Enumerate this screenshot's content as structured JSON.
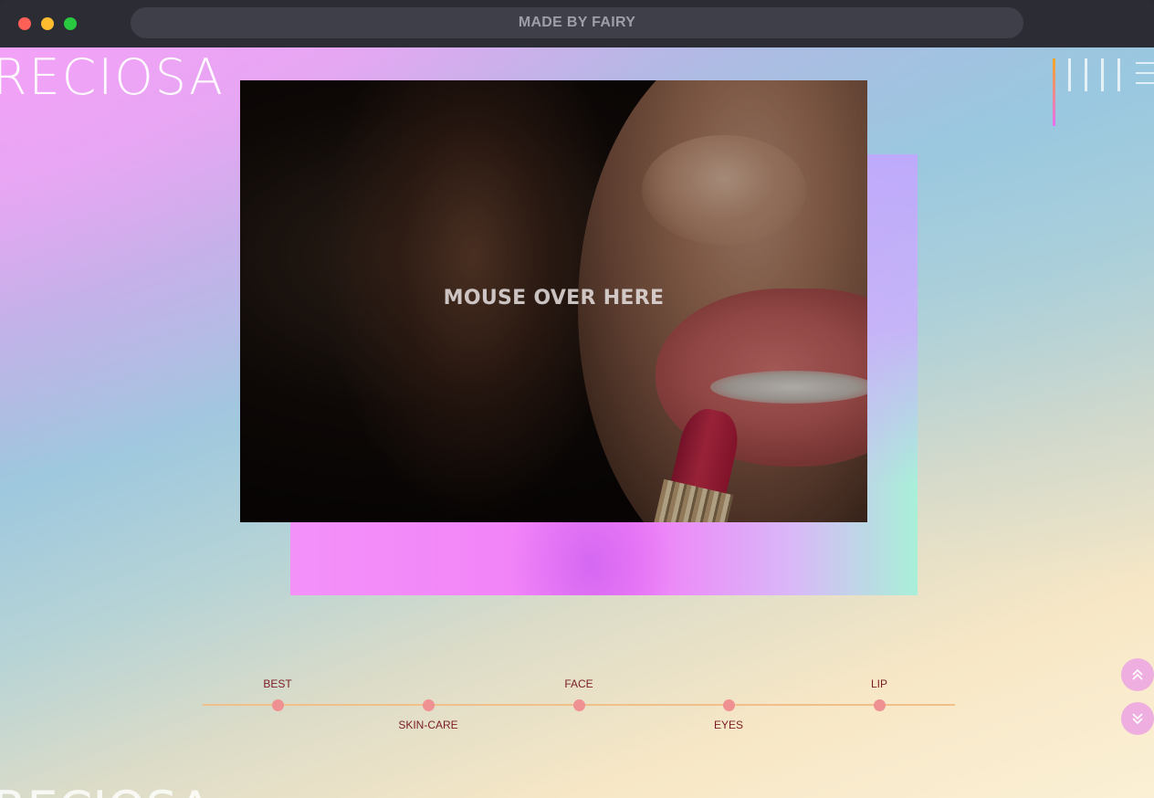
{
  "browser": {
    "url_title": "MADE BY FAIRY"
  },
  "brand": {
    "logo_text": "RECIOSA",
    "logo_bottom_text": "RECIOSA"
  },
  "hero": {
    "caption": "MOUSE OVER HERE"
  },
  "timeline": {
    "items": [
      {
        "label": "BEST",
        "position": "above"
      },
      {
        "label": "SKIN-CARE",
        "position": "below"
      },
      {
        "label": "FACE",
        "position": "above"
      },
      {
        "label": "EYES",
        "position": "below"
      },
      {
        "label": "LIP",
        "position": "above"
      }
    ]
  },
  "nav": {
    "section_bars": 5,
    "active_index": 0
  },
  "icons": {
    "scroll_up": "double-chevron-up-icon",
    "scroll_down": "double-chevron-down-icon",
    "menu": "hamburger-icon"
  },
  "colors": {
    "timeline_line": "#f0bf8a",
    "timeline_dot": "#ef9093",
    "timeline_label": "#7a1c25",
    "scroll_button": "#efaee0"
  }
}
